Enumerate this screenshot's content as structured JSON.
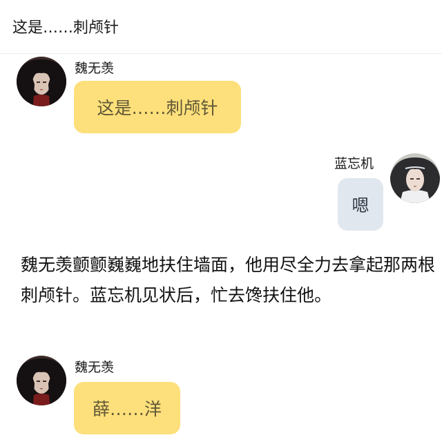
{
  "header": {
    "title": "这是……刺颅针"
  },
  "messages": [
    {
      "sender": "魏无羡",
      "text": "这是……刺颅针",
      "side": "left",
      "bubble_color": "#fde07b"
    },
    {
      "sender": "蓝忘机",
      "text": "嗯",
      "side": "right",
      "bubble_color": "#e1e7ef"
    },
    {
      "sender": "魏无羡",
      "text": "薛……洋",
      "side": "left",
      "bubble_color": "#fde07b"
    }
  ],
  "narration": "魏无羡颤颤巍巍地扶住墙面，他用尽全力去拿起那两根刺颅针。蓝忘机见状后，忙去馋扶住他。",
  "colors": {
    "left_bubble": "#fde07b",
    "right_bubble": "#e1e7ef",
    "divider": "#eeeeee"
  },
  "icons": {
    "left_avatar": "dark-haired-character-avatar",
    "right_avatar": "light-robed-character-avatar"
  }
}
